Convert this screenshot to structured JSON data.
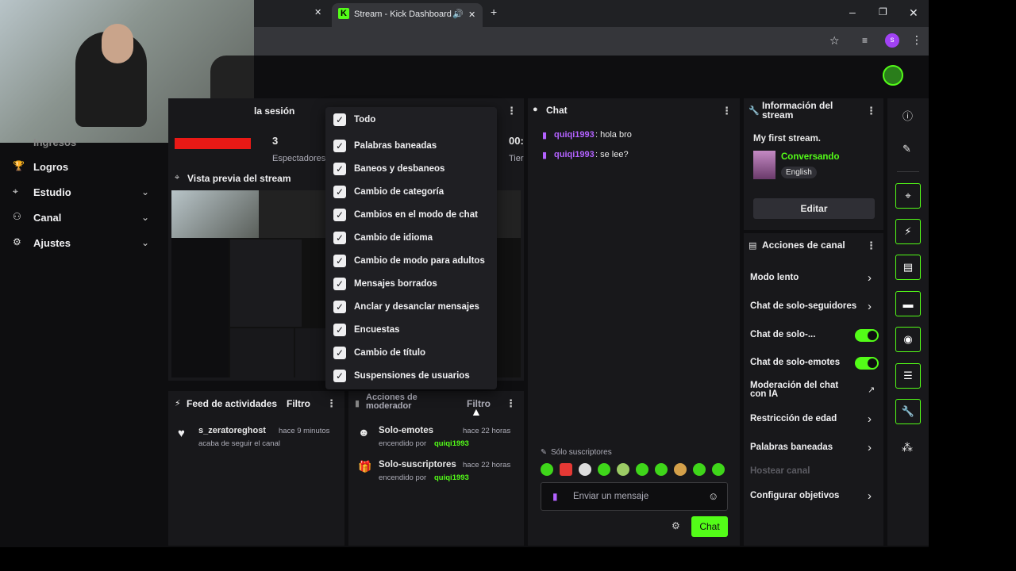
{
  "browser": {
    "tab_title": "Stream - Kick Dashboard",
    "tab_close": "✕",
    "new_tab": "+",
    "prev_tab_close": "✕",
    "minimize": "–",
    "restore": "❐",
    "close": "✕",
    "profile_initial": "s"
  },
  "sidebar": {
    "partial_top": "Ingresos",
    "items": [
      {
        "label": "Logros",
        "icon": "trophy-icon"
      },
      {
        "label": "Estudio",
        "icon": "studio-icon",
        "expand": true
      },
      {
        "label": "Canal",
        "icon": "channel-icon",
        "expand": true
      },
      {
        "label": "Ajustes",
        "icon": "gear-icon",
        "expand": true
      }
    ]
  },
  "session_panel": {
    "title": "la sesión",
    "stat_value": "3",
    "stat_label": "Espectadores",
    "time_value": "00:",
    "time_label": "Tier"
  },
  "preview_panel": {
    "title": "Vista previa del stream"
  },
  "filter_menu": {
    "items": [
      "Todo",
      "Palabras baneadas",
      "Baneos y desbaneos",
      "Cambio de categoría",
      "Cambios en el modo de chat",
      "Cambio de idioma",
      "Cambio de modo para adultos",
      "Mensajes borrados",
      "Anclar y desanclar mensajes",
      "Encuestas",
      "Cambio de título",
      "Suspensiones de usuarios"
    ]
  },
  "activity_feed": {
    "title": "Feed de actividades",
    "filter": "Filtro",
    "events": [
      {
        "user": "s_zeratoreghost",
        "time": "hace 9 minutos",
        "detail": "acaba de seguir el canal"
      }
    ]
  },
  "mod_actions": {
    "title": "Acciones de moderador",
    "filter": "Filtro",
    "events": [
      {
        "title": "Solo-emotes",
        "time": "hace 22 horas",
        "detail_prefix": "encendido por",
        "user": "quiqi1993"
      },
      {
        "title": "Solo-suscriptores",
        "time": "hace 22 horas",
        "detail_prefix": "encendido por",
        "user": "quiqi1993"
      }
    ]
  },
  "chat": {
    "title": "Chat",
    "messages": [
      {
        "user": "quiqi1993",
        "text": ": hola bro"
      },
      {
        "user": "quiqi1993",
        "text": ": se lee?"
      }
    ],
    "subs_only_label": "Sólo suscriptores",
    "input_placeholder": "Enviar un mensaje",
    "send_button": "Chat"
  },
  "stream_info": {
    "title": "Información del stream",
    "stream_title": "My first stream.",
    "category": "Conversando",
    "language": "English",
    "edit_button": "Editar"
  },
  "channel_actions": {
    "title": "Acciones de canal",
    "items": [
      {
        "label": "Modo lento",
        "control": "chevron"
      },
      {
        "label": "Chat de solo-seguidores",
        "control": "chevron"
      },
      {
        "label": "Chat de solo-...",
        "control": "toggle",
        "on": true
      },
      {
        "label": "Chat de solo-emotes",
        "control": "toggle",
        "on": true
      },
      {
        "label": "Moderación del chat con IA",
        "control": "external"
      },
      {
        "label": "Restricción de edad",
        "control": "chevron"
      },
      {
        "label": "Palabras baneadas",
        "control": "chevron"
      },
      {
        "label": "Hostear canal",
        "control": "none",
        "disabled": true
      },
      {
        "label": "Configurar objetivos",
        "control": "chevron"
      }
    ]
  },
  "colors": {
    "accent": "#53fc18",
    "username": "#b362ff",
    "panel": "#18181b",
    "background": "#0e0e10"
  }
}
